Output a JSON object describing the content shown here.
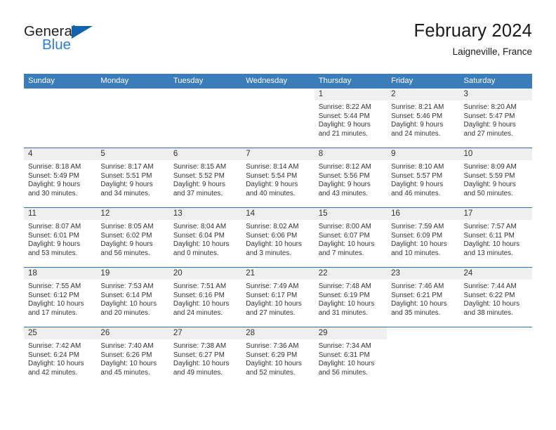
{
  "brand": {
    "name_part1": "General",
    "name_part2": "Blue",
    "triangle_icon": "triangle-logo-icon",
    "colors": {
      "dark": "#231f20",
      "blue": "#2a7fd4",
      "triangle": "#1163ab"
    }
  },
  "header": {
    "title": "February 2024",
    "subtitle": "Laigneville, France"
  },
  "theme": {
    "header_blue": "#3b7cbb",
    "row_divider_blue": "#2f6fae",
    "daynum_band": "#efefef",
    "text": "#333333"
  },
  "calendar": {
    "weekday_headers": [
      "Sunday",
      "Monday",
      "Tuesday",
      "Wednesday",
      "Thursday",
      "Friday",
      "Saturday"
    ],
    "weeks": [
      [
        {
          "day": "",
          "blank": true,
          "sunrise": "",
          "sunset": "",
          "daylight1": "",
          "daylight2": ""
        },
        {
          "day": "",
          "blank": true,
          "sunrise": "",
          "sunset": "",
          "daylight1": "",
          "daylight2": ""
        },
        {
          "day": "",
          "blank": true,
          "sunrise": "",
          "sunset": "",
          "daylight1": "",
          "daylight2": ""
        },
        {
          "day": "",
          "blank": true,
          "sunrise": "",
          "sunset": "",
          "daylight1": "",
          "daylight2": ""
        },
        {
          "day": "1",
          "blank": false,
          "sunrise": "Sunrise: 8:22 AM",
          "sunset": "Sunset: 5:44 PM",
          "daylight1": "Daylight: 9 hours",
          "daylight2": "and 21 minutes."
        },
        {
          "day": "2",
          "blank": false,
          "sunrise": "Sunrise: 8:21 AM",
          "sunset": "Sunset: 5:46 PM",
          "daylight1": "Daylight: 9 hours",
          "daylight2": "and 24 minutes."
        },
        {
          "day": "3",
          "blank": false,
          "sunrise": "Sunrise: 8:20 AM",
          "sunset": "Sunset: 5:47 PM",
          "daylight1": "Daylight: 9 hours",
          "daylight2": "and 27 minutes."
        }
      ],
      [
        {
          "day": "4",
          "blank": false,
          "sunrise": "Sunrise: 8:18 AM",
          "sunset": "Sunset: 5:49 PM",
          "daylight1": "Daylight: 9 hours",
          "daylight2": "and 30 minutes."
        },
        {
          "day": "5",
          "blank": false,
          "sunrise": "Sunrise: 8:17 AM",
          "sunset": "Sunset: 5:51 PM",
          "daylight1": "Daylight: 9 hours",
          "daylight2": "and 34 minutes."
        },
        {
          "day": "6",
          "blank": false,
          "sunrise": "Sunrise: 8:15 AM",
          "sunset": "Sunset: 5:52 PM",
          "daylight1": "Daylight: 9 hours",
          "daylight2": "and 37 minutes."
        },
        {
          "day": "7",
          "blank": false,
          "sunrise": "Sunrise: 8:14 AM",
          "sunset": "Sunset: 5:54 PM",
          "daylight1": "Daylight: 9 hours",
          "daylight2": "and 40 minutes."
        },
        {
          "day": "8",
          "blank": false,
          "sunrise": "Sunrise: 8:12 AM",
          "sunset": "Sunset: 5:56 PM",
          "daylight1": "Daylight: 9 hours",
          "daylight2": "and 43 minutes."
        },
        {
          "day": "9",
          "blank": false,
          "sunrise": "Sunrise: 8:10 AM",
          "sunset": "Sunset: 5:57 PM",
          "daylight1": "Daylight: 9 hours",
          "daylight2": "and 46 minutes."
        },
        {
          "day": "10",
          "blank": false,
          "sunrise": "Sunrise: 8:09 AM",
          "sunset": "Sunset: 5:59 PM",
          "daylight1": "Daylight: 9 hours",
          "daylight2": "and 50 minutes."
        }
      ],
      [
        {
          "day": "11",
          "blank": false,
          "sunrise": "Sunrise: 8:07 AM",
          "sunset": "Sunset: 6:01 PM",
          "daylight1": "Daylight: 9 hours",
          "daylight2": "and 53 minutes."
        },
        {
          "day": "12",
          "blank": false,
          "sunrise": "Sunrise: 8:05 AM",
          "sunset": "Sunset: 6:02 PM",
          "daylight1": "Daylight: 9 hours",
          "daylight2": "and 56 minutes."
        },
        {
          "day": "13",
          "blank": false,
          "sunrise": "Sunrise: 8:04 AM",
          "sunset": "Sunset: 6:04 PM",
          "daylight1": "Daylight: 10 hours",
          "daylight2": "and 0 minutes."
        },
        {
          "day": "14",
          "blank": false,
          "sunrise": "Sunrise: 8:02 AM",
          "sunset": "Sunset: 6:06 PM",
          "daylight1": "Daylight: 10 hours",
          "daylight2": "and 3 minutes."
        },
        {
          "day": "15",
          "blank": false,
          "sunrise": "Sunrise: 8:00 AM",
          "sunset": "Sunset: 6:07 PM",
          "daylight1": "Daylight: 10 hours",
          "daylight2": "and 7 minutes."
        },
        {
          "day": "16",
          "blank": false,
          "sunrise": "Sunrise: 7:59 AM",
          "sunset": "Sunset: 6:09 PM",
          "daylight1": "Daylight: 10 hours",
          "daylight2": "and 10 minutes."
        },
        {
          "day": "17",
          "blank": false,
          "sunrise": "Sunrise: 7:57 AM",
          "sunset": "Sunset: 6:11 PM",
          "daylight1": "Daylight: 10 hours",
          "daylight2": "and 13 minutes."
        }
      ],
      [
        {
          "day": "18",
          "blank": false,
          "sunrise": "Sunrise: 7:55 AM",
          "sunset": "Sunset: 6:12 PM",
          "daylight1": "Daylight: 10 hours",
          "daylight2": "and 17 minutes."
        },
        {
          "day": "19",
          "blank": false,
          "sunrise": "Sunrise: 7:53 AM",
          "sunset": "Sunset: 6:14 PM",
          "daylight1": "Daylight: 10 hours",
          "daylight2": "and 20 minutes."
        },
        {
          "day": "20",
          "blank": false,
          "sunrise": "Sunrise: 7:51 AM",
          "sunset": "Sunset: 6:16 PM",
          "daylight1": "Daylight: 10 hours",
          "daylight2": "and 24 minutes."
        },
        {
          "day": "21",
          "blank": false,
          "sunrise": "Sunrise: 7:49 AM",
          "sunset": "Sunset: 6:17 PM",
          "daylight1": "Daylight: 10 hours",
          "daylight2": "and 27 minutes."
        },
        {
          "day": "22",
          "blank": false,
          "sunrise": "Sunrise: 7:48 AM",
          "sunset": "Sunset: 6:19 PM",
          "daylight1": "Daylight: 10 hours",
          "daylight2": "and 31 minutes."
        },
        {
          "day": "23",
          "blank": false,
          "sunrise": "Sunrise: 7:46 AM",
          "sunset": "Sunset: 6:21 PM",
          "daylight1": "Daylight: 10 hours",
          "daylight2": "and 35 minutes."
        },
        {
          "day": "24",
          "blank": false,
          "sunrise": "Sunrise: 7:44 AM",
          "sunset": "Sunset: 6:22 PM",
          "daylight1": "Daylight: 10 hours",
          "daylight2": "and 38 minutes."
        }
      ],
      [
        {
          "day": "25",
          "blank": false,
          "sunrise": "Sunrise: 7:42 AM",
          "sunset": "Sunset: 6:24 PM",
          "daylight1": "Daylight: 10 hours",
          "daylight2": "and 42 minutes."
        },
        {
          "day": "26",
          "blank": false,
          "sunrise": "Sunrise: 7:40 AM",
          "sunset": "Sunset: 6:26 PM",
          "daylight1": "Daylight: 10 hours",
          "daylight2": "and 45 minutes."
        },
        {
          "day": "27",
          "blank": false,
          "sunrise": "Sunrise: 7:38 AM",
          "sunset": "Sunset: 6:27 PM",
          "daylight1": "Daylight: 10 hours",
          "daylight2": "and 49 minutes."
        },
        {
          "day": "28",
          "blank": false,
          "sunrise": "Sunrise: 7:36 AM",
          "sunset": "Sunset: 6:29 PM",
          "daylight1": "Daylight: 10 hours",
          "daylight2": "and 52 minutes."
        },
        {
          "day": "29",
          "blank": false,
          "sunrise": "Sunrise: 7:34 AM",
          "sunset": "Sunset: 6:31 PM",
          "daylight1": "Daylight: 10 hours",
          "daylight2": "and 56 minutes."
        },
        {
          "day": "",
          "blank": true,
          "sunrise": "",
          "sunset": "",
          "daylight1": "",
          "daylight2": ""
        },
        {
          "day": "",
          "blank": true,
          "sunrise": "",
          "sunset": "",
          "daylight1": "",
          "daylight2": ""
        }
      ]
    ]
  }
}
